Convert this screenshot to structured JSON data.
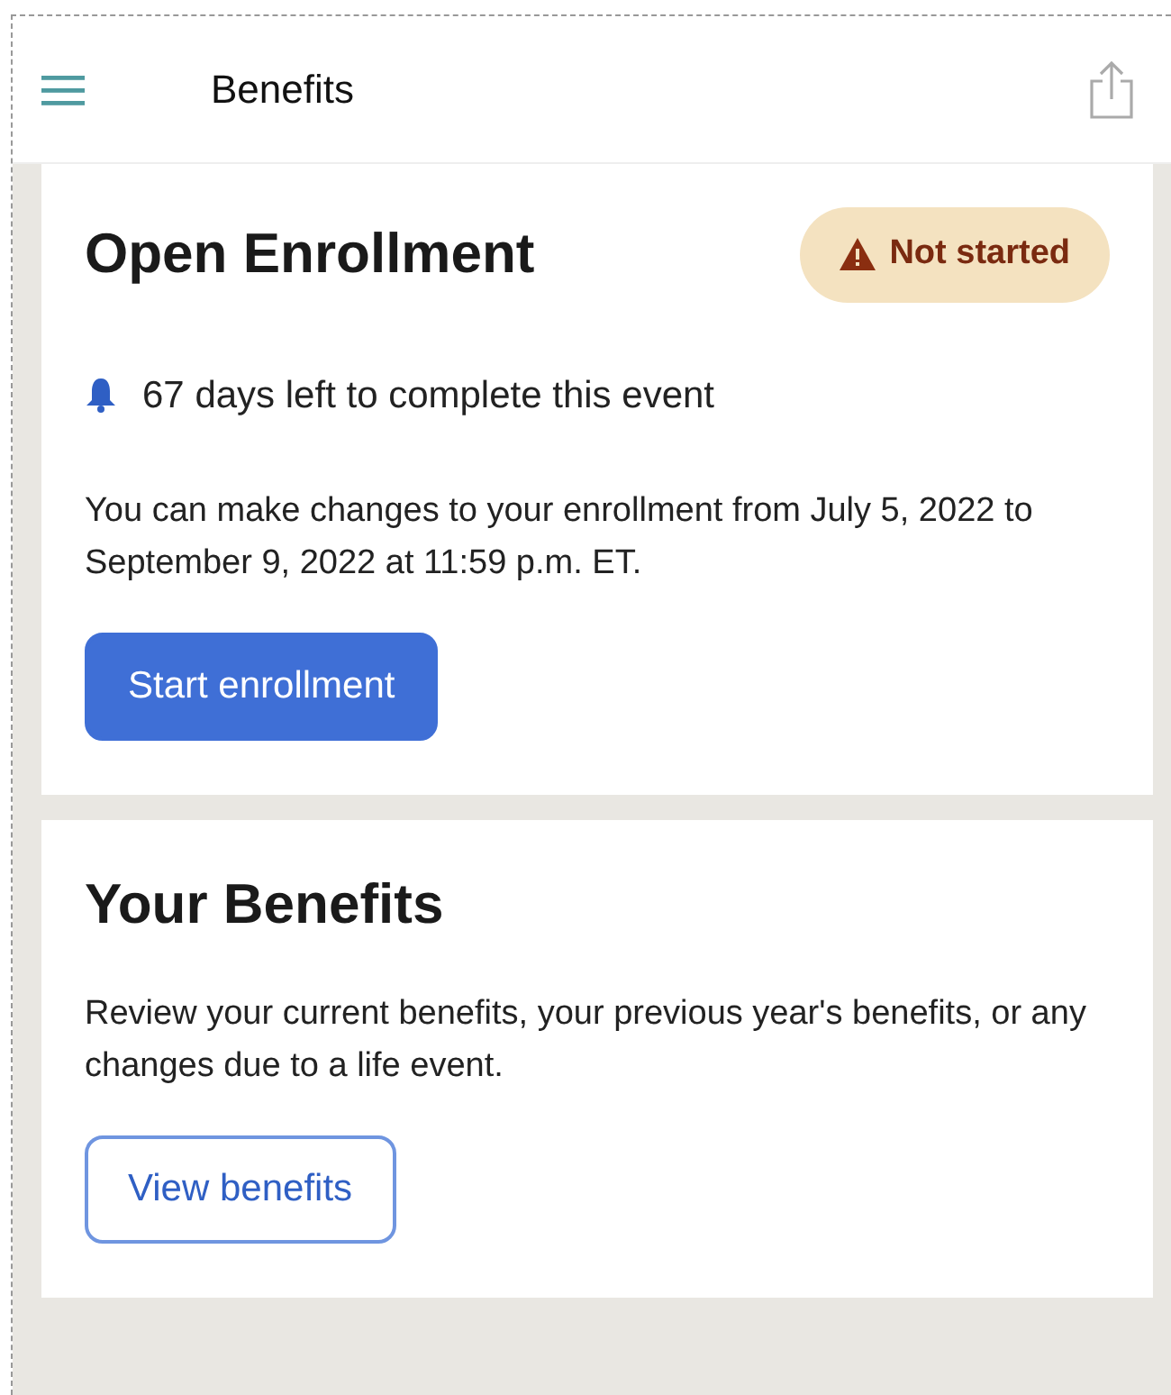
{
  "header": {
    "title": "Benefits"
  },
  "cards": [
    {
      "title": "Open Enrollment",
      "badge": {
        "label": "Not started"
      },
      "notice": "67 days left to complete this event",
      "body": "You can make changes to your enrollment from July 5, 2022 to September 9, 2022 at 11:59 p.m. ET.",
      "button": {
        "label": "Start enrollment",
        "kind": "primary"
      }
    },
    {
      "title": "Your Benefits",
      "body": "Review your current benefits, your previous year's benefits, or any changes due to a life event.",
      "button": {
        "label": "View benefits",
        "kind": "outline"
      }
    }
  ]
}
